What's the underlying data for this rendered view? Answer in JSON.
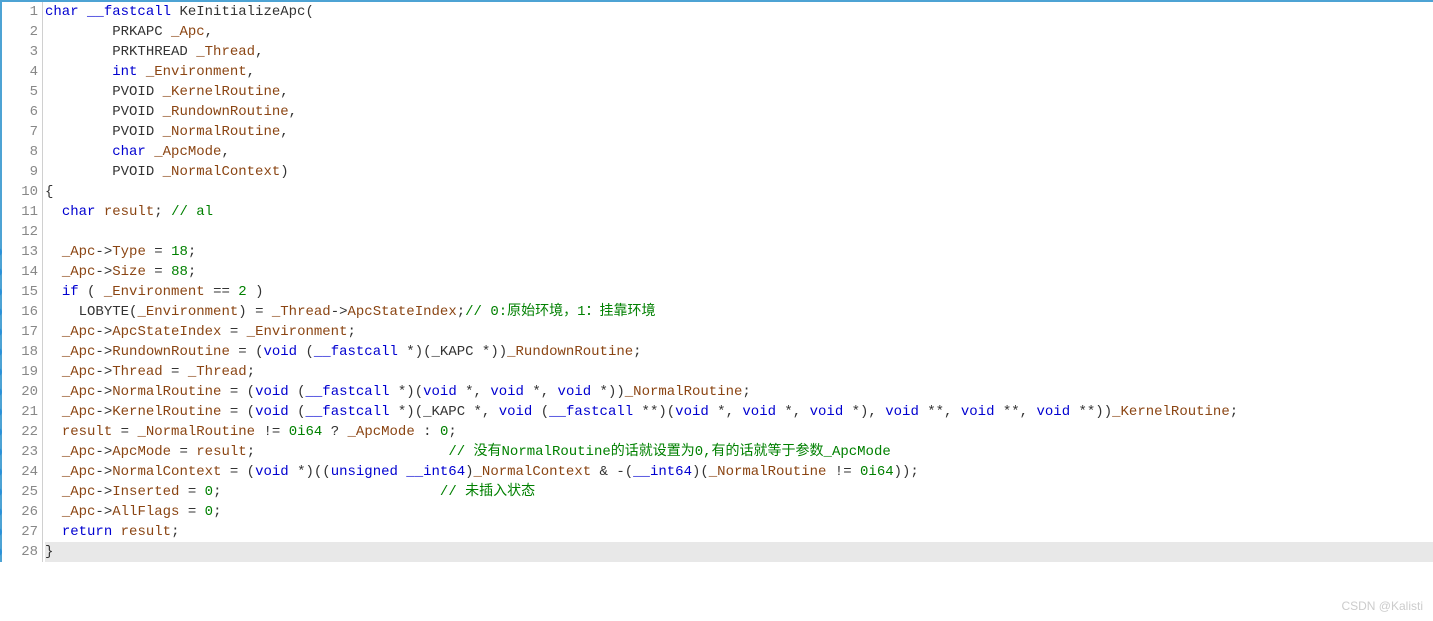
{
  "gutter": {
    "start": 1,
    "end": 28
  },
  "breakpoints": [
    13,
    14,
    15,
    16,
    17,
    18,
    19,
    20,
    21,
    22,
    23,
    24,
    25,
    26,
    27,
    28
  ],
  "highlight": 28,
  "code": {
    "l1": {
      "kw1": "char",
      "kw2": "__fastcall",
      "fn": "KeInitializeApc",
      "paren": "("
    },
    "l2": {
      "type": "PRKAPC",
      "name": "_Apc",
      "comma": ","
    },
    "l3": {
      "type": "PRKTHREAD",
      "name": "_Thread",
      "comma": ","
    },
    "l4": {
      "type": "int",
      "name": "_Environment",
      "comma": ","
    },
    "l5": {
      "type": "PVOID",
      "name": "_KernelRoutine",
      "comma": ","
    },
    "l6": {
      "type": "PVOID",
      "name": "_RundownRoutine",
      "comma": ","
    },
    "l7": {
      "type": "PVOID",
      "name": "_NormalRoutine",
      "comma": ","
    },
    "l8": {
      "type": "char",
      "name": "_ApcMode",
      "comma": ","
    },
    "l9": {
      "type": "PVOID",
      "name": "_NormalContext",
      "close": ")"
    },
    "l10": {
      "brace": "{"
    },
    "l11": {
      "kw": "char",
      "var": "result",
      "comment": "// al"
    },
    "l12": "",
    "l13": {
      "obj": "_Apc",
      "arrow": "->",
      "field": "Type",
      "eq": " = ",
      "val": "18",
      "semi": ";"
    },
    "l14": {
      "obj": "_Apc",
      "arrow": "->",
      "field": "Size",
      "eq": " = ",
      "val": "88",
      "semi": ";"
    },
    "l15": {
      "kw": "if",
      "open": " ( ",
      "var": "_Environment",
      "op": " == ",
      "val": "2",
      "close": " )"
    },
    "l16": {
      "fn": "LOBYTE",
      "open": "(",
      "arg": "_Environment",
      "close": ") = ",
      "obj": "_Thread",
      "arrow": "->",
      "field": "ApcStateIndex",
      "semi": ";",
      "comment": "// 0:原始环境，1：挂靠环境"
    },
    "l17": {
      "obj": "_Apc",
      "arrow": "->",
      "field": "ApcStateIndex",
      "eq": " = ",
      "var": "_Environment",
      "semi": ";"
    },
    "l18": {
      "obj": "_Apc",
      "arrow": "->",
      "field": "RundownRoutine",
      "eq": " = (",
      "kw1": "void",
      "sp": " (",
      "kw2": "__fastcall",
      "cast": " *)(_KAPC *))",
      "var": "_RundownRoutine",
      "semi": ";"
    },
    "l19": {
      "obj": "_Apc",
      "arrow": "->",
      "field": "Thread",
      "eq": " = ",
      "var": "_Thread",
      "semi": ";"
    },
    "l20": {
      "obj": "_Apc",
      "arrow": "->",
      "field": "NormalRoutine",
      "eq": " = (",
      "kw1": "void",
      "sp": " (",
      "kw2": "__fastcall",
      "cast": " *)(",
      "kw3": "void",
      "c1": " *, ",
      "kw4": "void",
      "c2": " *, ",
      "kw5": "void",
      "c3": " *))",
      "var": "_NormalRoutine",
      "semi": ";"
    },
    "l21": {
      "obj": "_Apc",
      "arrow": "->",
      "field": "KernelRoutine",
      "eq": " = (",
      "kw1": "void",
      "sp": " (",
      "kw2": "__fastcall",
      "cast1": " *)(_KAPC *, ",
      "kw3": "void",
      "sp2": " (",
      "kw4": "__fastcall",
      "cast2": " **)(",
      "kw5": "void",
      "c1": " *, ",
      "kw6": "void",
      "c2": " *, ",
      "kw7": "void",
      "c3": " *), ",
      "kw8": "void",
      "c4": " **, ",
      "kw9": "void",
      "c5": " **, ",
      "kw10": "void",
      "c6": " **))",
      "var": "_KernelRoutine",
      "semi": ";"
    },
    "l22": {
      "var1": "result",
      "eq": " = ",
      "var2": "_NormalRoutine",
      "op": " != ",
      "val1": "0i64",
      "tern": " ? ",
      "var3": "_ApcMode",
      "colon": " : ",
      "val2": "0",
      "semi": ";"
    },
    "l23": {
      "obj": "_Apc",
      "arrow": "->",
      "field": "ApcMode",
      "eq": " = ",
      "var": "result",
      "semi": ";",
      "comment": "// 没有NormalRoutine的话就设置为0,有的话就等于参数_ApcMode"
    },
    "l24": {
      "obj": "_Apc",
      "arrow": "->",
      "field": "NormalContext",
      "eq": " = (",
      "kw1": "void",
      "cast1": " *)((",
      "kw2": "unsigned __int64",
      "close1": ")",
      "var1": "_NormalContext",
      "op1": " & -(",
      "kw3": "__int64",
      "close2": ")(",
      "var2": "_NormalRoutine",
      "op2": " != ",
      "val": "0i64",
      "close3": "));"
    },
    "l25": {
      "obj": "_Apc",
      "arrow": "->",
      "field": "Inserted",
      "eq": " = ",
      "val": "0",
      "semi": ";",
      "comment": "// 未插入状态"
    },
    "l26": {
      "obj": "_Apc",
      "arrow": "->",
      "field": "AllFlags",
      "eq": " = ",
      "val": "0",
      "semi": ";"
    },
    "l27": {
      "kw": "return",
      "sp": " ",
      "var": "result",
      "semi": ";"
    },
    "l28": {
      "brace": "}"
    }
  },
  "watermark": "CSDN @Kalisti"
}
